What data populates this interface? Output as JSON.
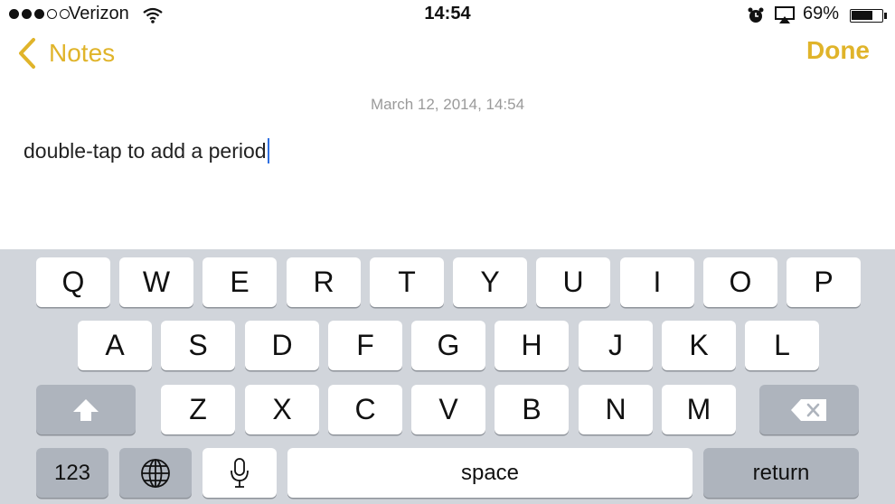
{
  "status_bar": {
    "carrier": "Verizon",
    "time": "14:54",
    "battery": "69%",
    "icons": [
      "signal-dots",
      "wifi-icon",
      "alarm-icon",
      "airplay-icon",
      "battery-icon"
    ]
  },
  "nav": {
    "back_label": "Notes",
    "done_label": "Done",
    "accent_color": "#e0b42a"
  },
  "note": {
    "date": "March 12, 2014, 14:54",
    "text": "double-tap to add a period"
  },
  "keyboard": {
    "row1": [
      "Q",
      "W",
      "E",
      "R",
      "T",
      "Y",
      "U",
      "I",
      "O",
      "P"
    ],
    "row2": [
      "A",
      "S",
      "D",
      "F",
      "G",
      "H",
      "J",
      "K",
      "L"
    ],
    "row3": [
      "Z",
      "X",
      "C",
      "V",
      "B",
      "N",
      "M"
    ],
    "numbers_label": "123",
    "space_label": "space",
    "return_label": "return",
    "function_icons": [
      "shift-icon",
      "delete-icon",
      "globe-icon",
      "mic-icon"
    ]
  }
}
